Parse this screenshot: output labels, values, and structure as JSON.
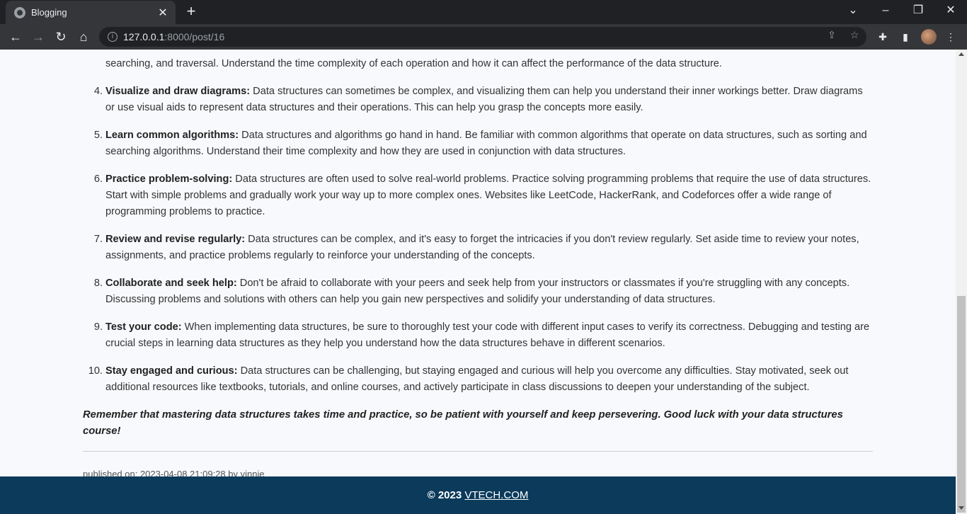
{
  "browser": {
    "tab_title": "Blogging",
    "tab_close": "✕",
    "new_tab": "+",
    "url_host": "127.0.0.1",
    "url_path": ":8000/post/16"
  },
  "post": {
    "partial_item": "searching, and traversal. Understand the time complexity of each operation and how it can affect the performance of the data structure.",
    "items": [
      {
        "num": "4.",
        "title": "Visualize and draw diagrams:",
        "text": " Data structures can sometimes be complex, and visualizing them can help you understand their inner workings better. Draw diagrams or use visual aids to represent data structures and their operations. This can help you grasp the concepts more easily."
      },
      {
        "num": "5.",
        "title": "Learn common algorithms:",
        "text": " Data structures and algorithms go hand in hand. Be familiar with common algorithms that operate on data structures, such as sorting and searching algorithms. Understand their time complexity and how they are used in conjunction with data structures."
      },
      {
        "num": "6.",
        "title": "Practice problem-solving:",
        "text": " Data structures are often used to solve real-world problems. Practice solving programming problems that require the use of data structures. Start with simple problems and gradually work your way up to more complex ones. Websites like LeetCode, HackerRank, and Codeforces offer a wide range of programming problems to practice."
      },
      {
        "num": "7.",
        "title": "Review and revise regularly:",
        "text": " Data structures can be complex, and it's easy to forget the intricacies if you don't review regularly. Set aside time to review your notes, assignments, and practice problems regularly to reinforce your understanding of the concepts."
      },
      {
        "num": "8.",
        "title": "Collaborate and seek help:",
        "text": " Don't be afraid to collaborate with your peers and seek help from your instructors or classmates if you're struggling with any concepts. Discussing problems and solutions with others can help you gain new perspectives and solidify your understanding of data structures."
      },
      {
        "num": "9.",
        "title": "Test your code:",
        "text": " When implementing data structures, be sure to thoroughly test your code with different input cases to verify its correctness. Debugging and testing are crucial steps in learning data structures as they help you understand how the data structures behave in different scenarios."
      },
      {
        "num": "10.",
        "title": "Stay engaged and curious:",
        "text": " Data structures can be challenging, but staying engaged and curious will help you overcome any difficulties. Stay motivated, seek out additional resources like textbooks, tutorials, and online courses, and actively participate in class discussions to deepen your understanding of the subject."
      }
    ],
    "closing": "Remember that mastering data structures takes time and practice, so be patient with yourself and keep persevering. Good luck with your data structures course!",
    "meta": "published on: 2023-04-08 21:09:28 by vinnie"
  },
  "footer": {
    "copyright": "© 2023 ",
    "link": "VTECH.COM"
  }
}
